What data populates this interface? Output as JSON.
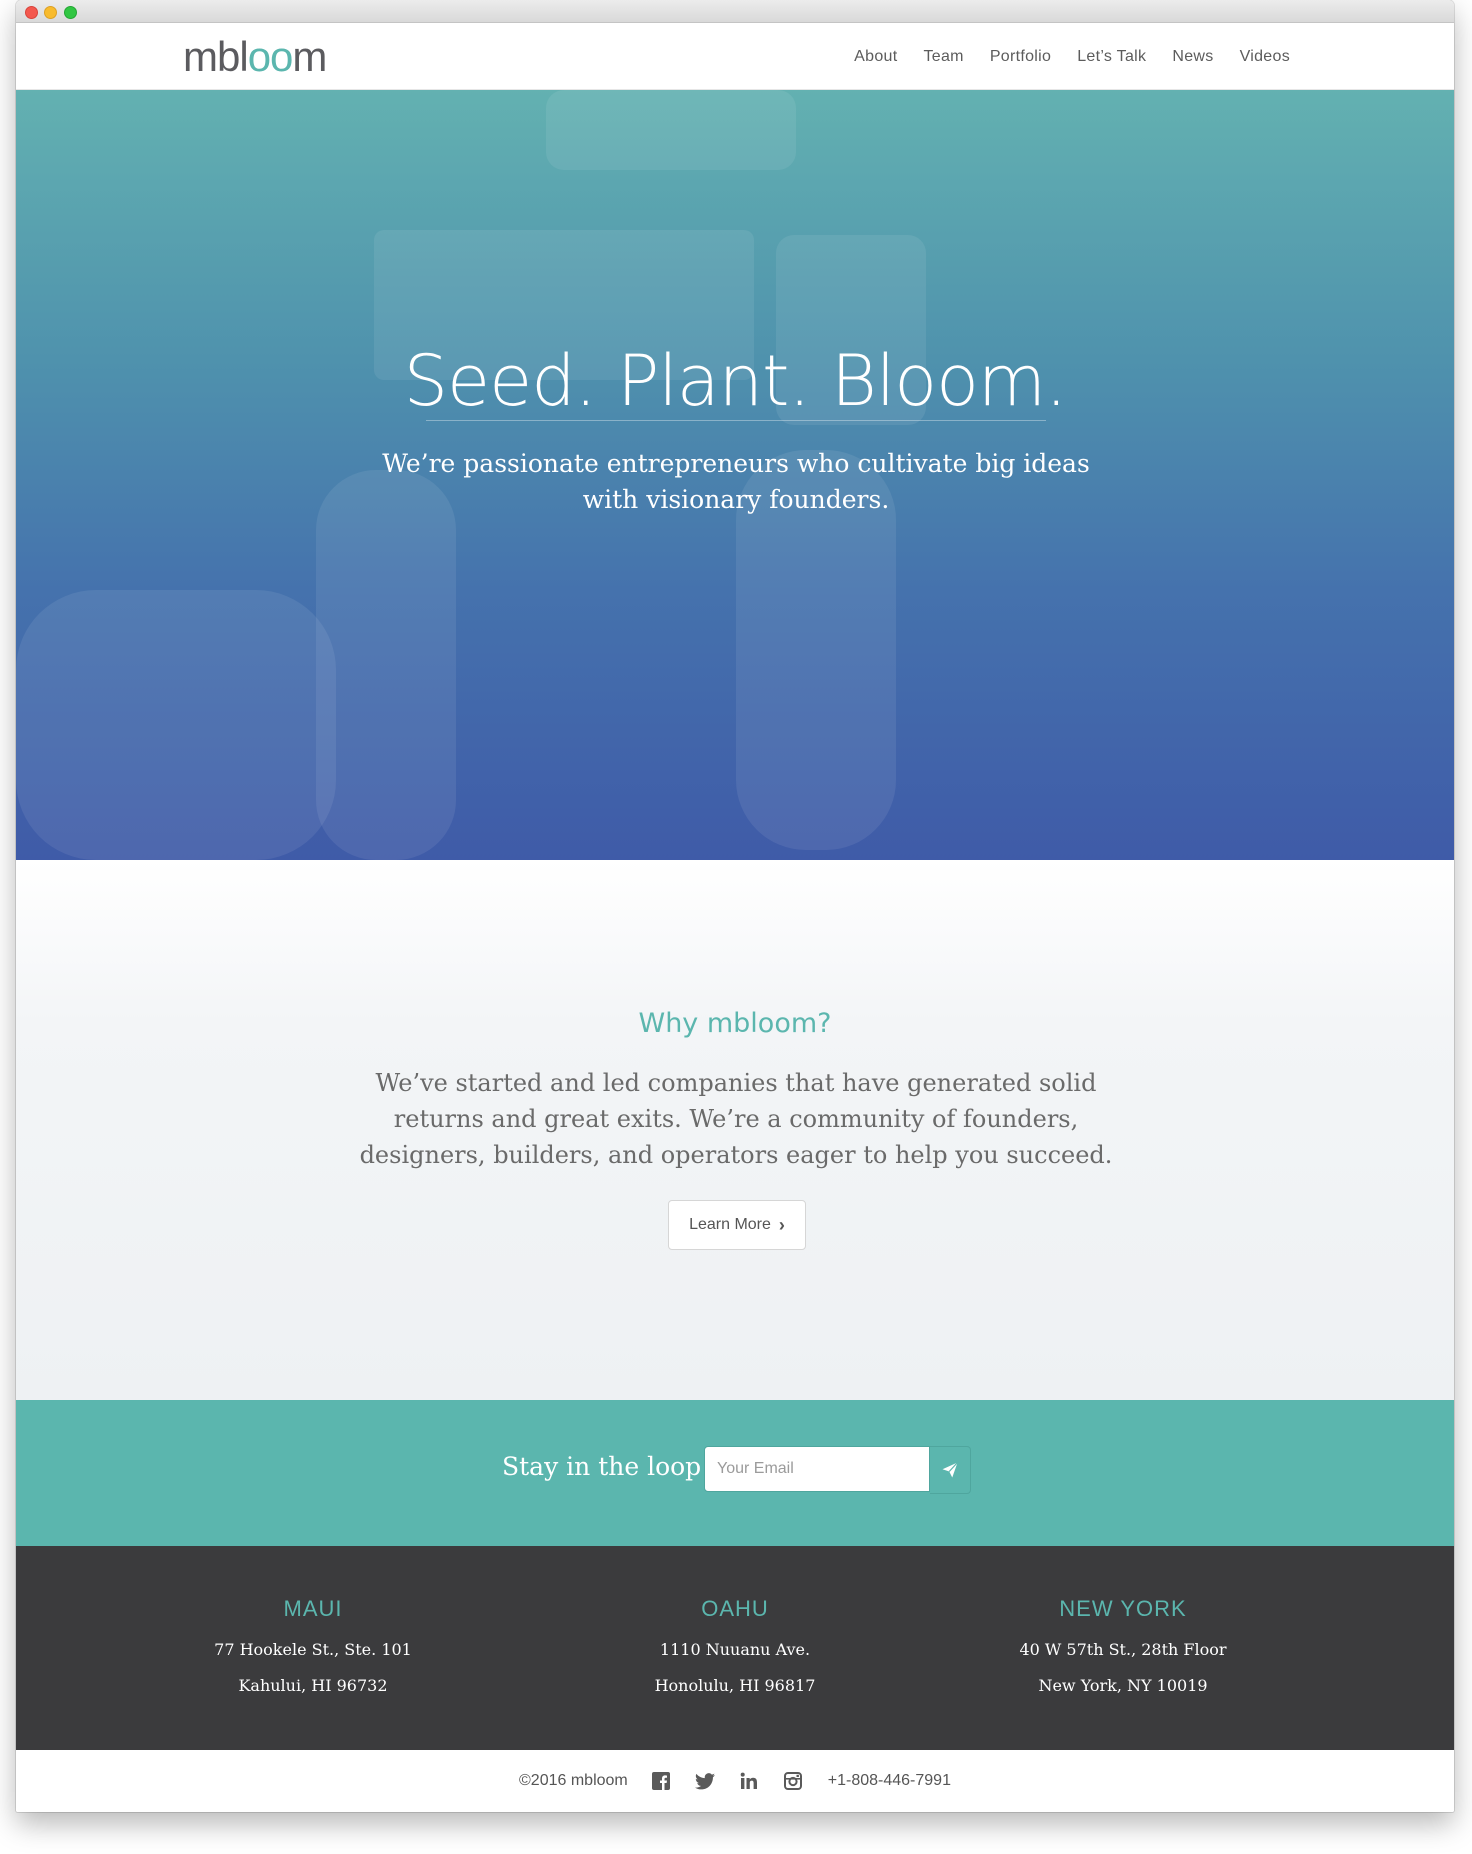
{
  "brand": {
    "logo_pre": "mbl",
    "logo_oo": "oo",
    "logo_post": "m"
  },
  "nav": {
    "items": [
      "About",
      "Team",
      "Portfolio",
      "Let’s Talk",
      "News",
      "Videos"
    ]
  },
  "hero": {
    "title": "Seed. Plant. Bloom.",
    "subtitle": "We’re passionate entrepreneurs who cultivate big ideas with visionary founders."
  },
  "why": {
    "title": "Why mbloom?",
    "body": "We’ve started and led companies that have generated solid returns and great exits. We’re a community of founders, designers, builders, and operators eager to help you succeed.",
    "button_label": "Learn More"
  },
  "newsletter": {
    "label": "Stay in the loop",
    "email_placeholder": "Your Email",
    "send_icon": "paper-plane-icon"
  },
  "offices": [
    {
      "name": "MAUI",
      "line1": "77 Hookele St., Ste. 101",
      "line2": "Kahului, HI 96732"
    },
    {
      "name": "OAHU",
      "line1": "1110 Nuuanu Ave.",
      "line2": "Honolulu, HI 96817"
    },
    {
      "name": "NEW YORK",
      "line1": "40 W 57th St., 28th Floor",
      "line2": "New York, NY 10019"
    }
  ],
  "footer": {
    "copyright": "©2016 mbloom",
    "social_icons": [
      "facebook-icon",
      "twitter-icon",
      "linkedin-icon",
      "instagram-icon"
    ],
    "phone": "+1-808-446-7991"
  },
  "colors": {
    "accent": "#5bb6ae",
    "hero_top": "#63b1b1",
    "hero_bottom": "#3f5ba8",
    "footer_dark": "#3b3b3d"
  }
}
